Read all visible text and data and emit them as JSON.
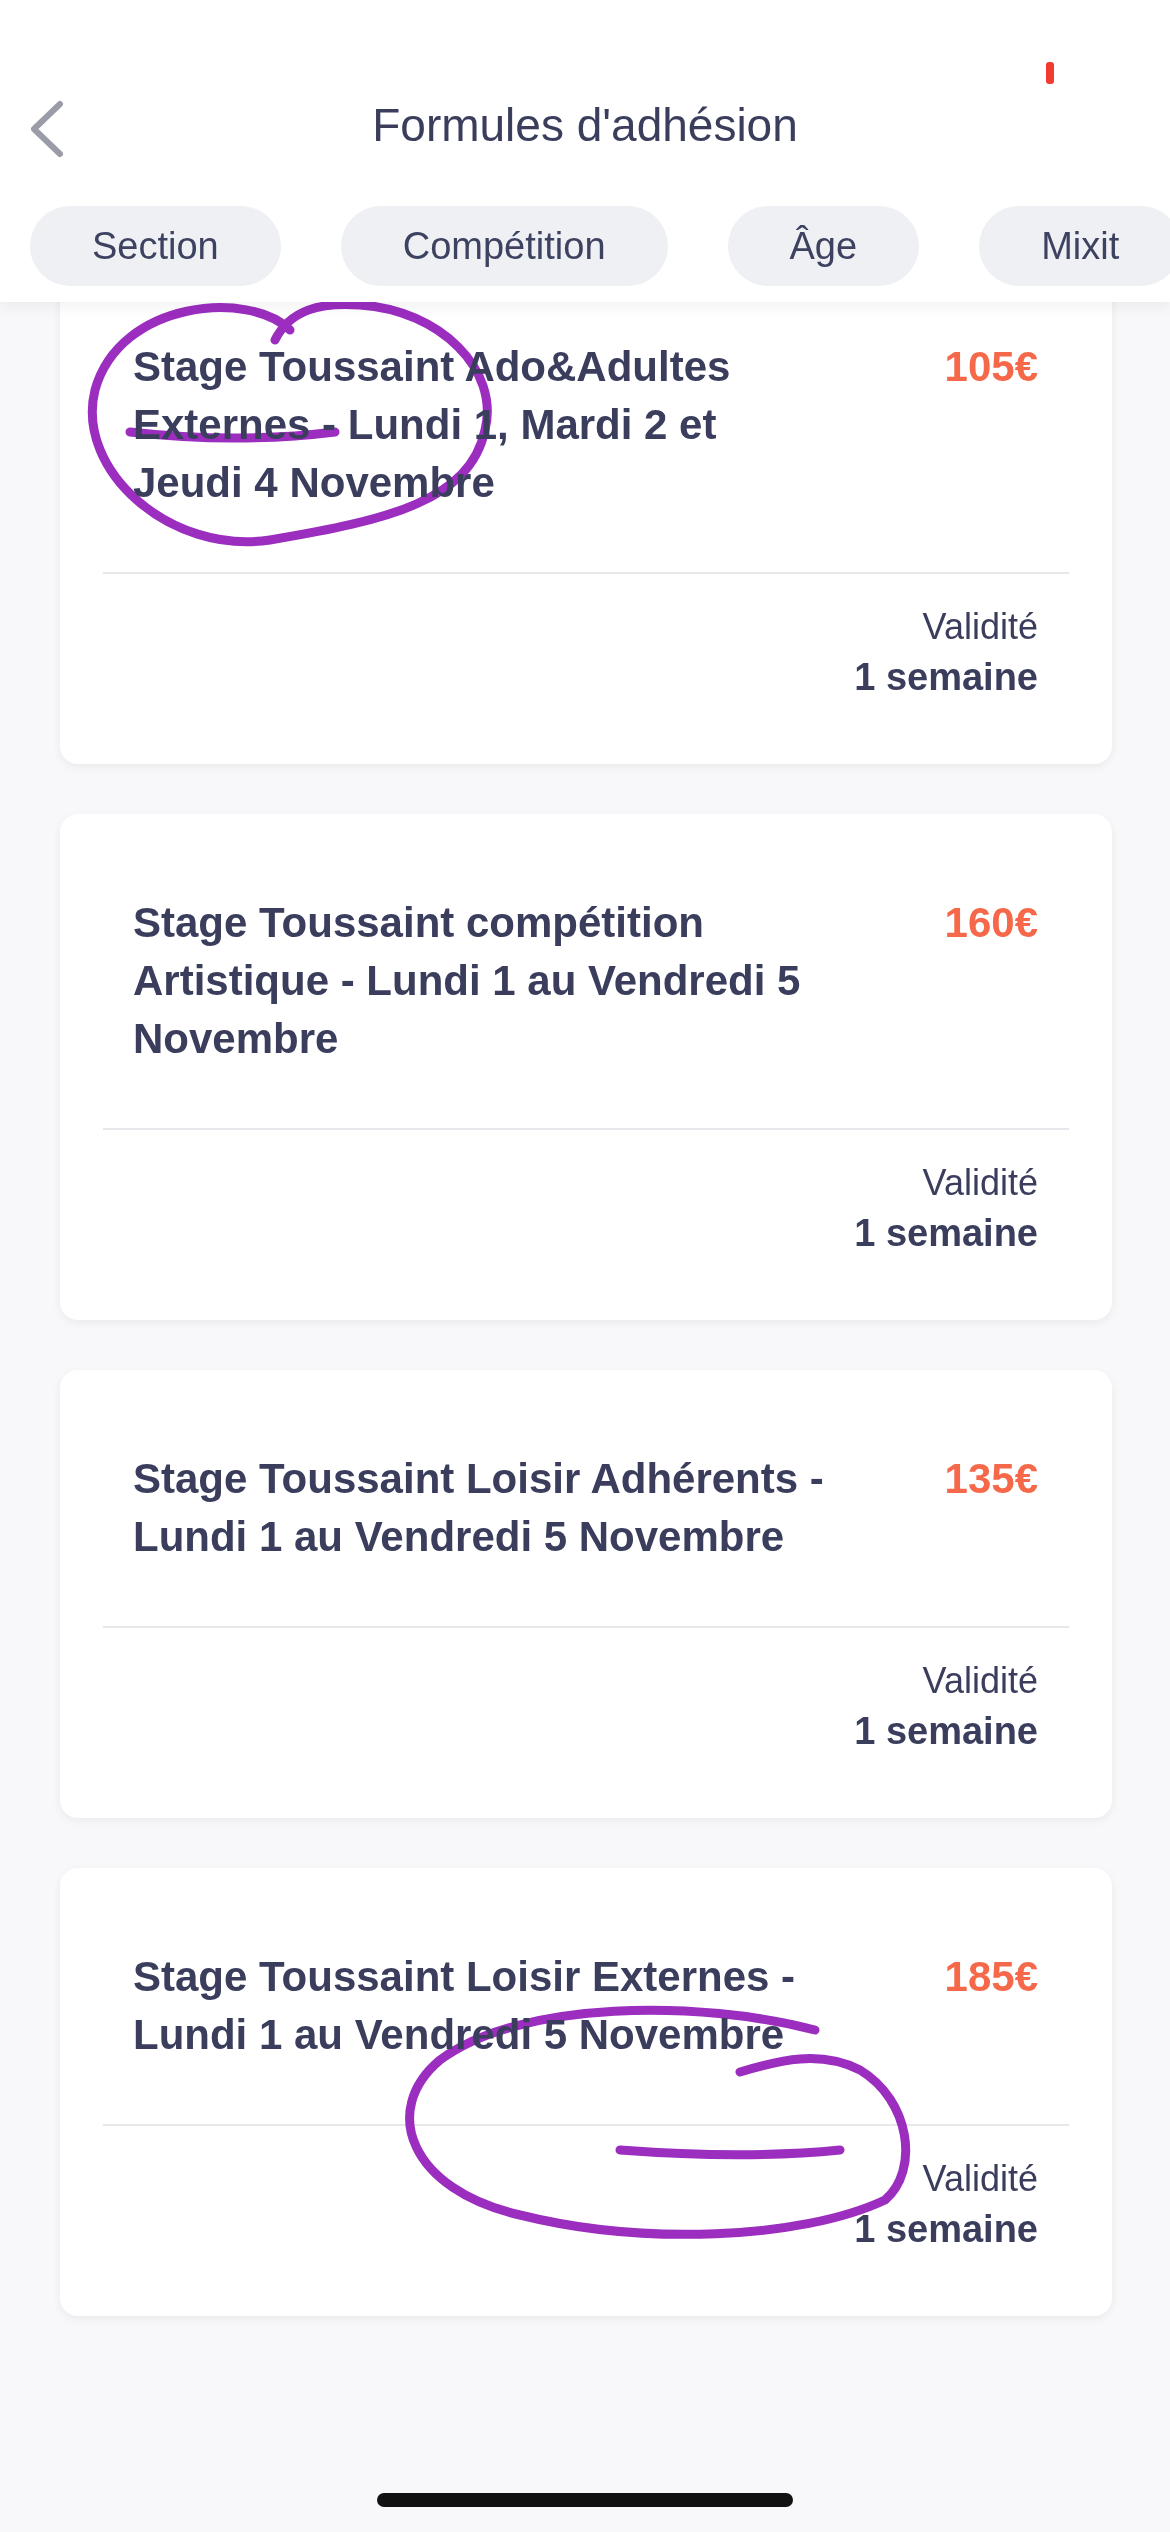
{
  "header": {
    "title": "Formules d'adhésion"
  },
  "filters": [
    {
      "label": "Section"
    },
    {
      "label": "Compétition"
    },
    {
      "label": "Âge"
    },
    {
      "label": "Mixit"
    }
  ],
  "offers": [
    {
      "title": "Stage Toussaint Ado&Adultes Externes - Lundi 1, Mardi 2 et Jeudi 4 Novembre",
      "price": "105€",
      "validity_label": "Validité",
      "validity": "1 semaine"
    },
    {
      "title": "Stage Toussaint compétition Artistique - Lundi 1 au Vendredi 5 Novembre",
      "price": "160€",
      "validity_label": "Validité",
      "validity": "1 semaine"
    },
    {
      "title": "Stage Toussaint Loisir Adhérents - Lundi 1 au Vendredi 5 Novembre",
      "price": "135€",
      "validity_label": "Validité",
      "validity": "1 semaine"
    },
    {
      "title": "Stage Toussaint Loisir Externes - Lundi 1 au Vendredi 5 Novembre",
      "price": "185€",
      "validity_label": "Validité",
      "validity": "1 semaine"
    }
  ]
}
